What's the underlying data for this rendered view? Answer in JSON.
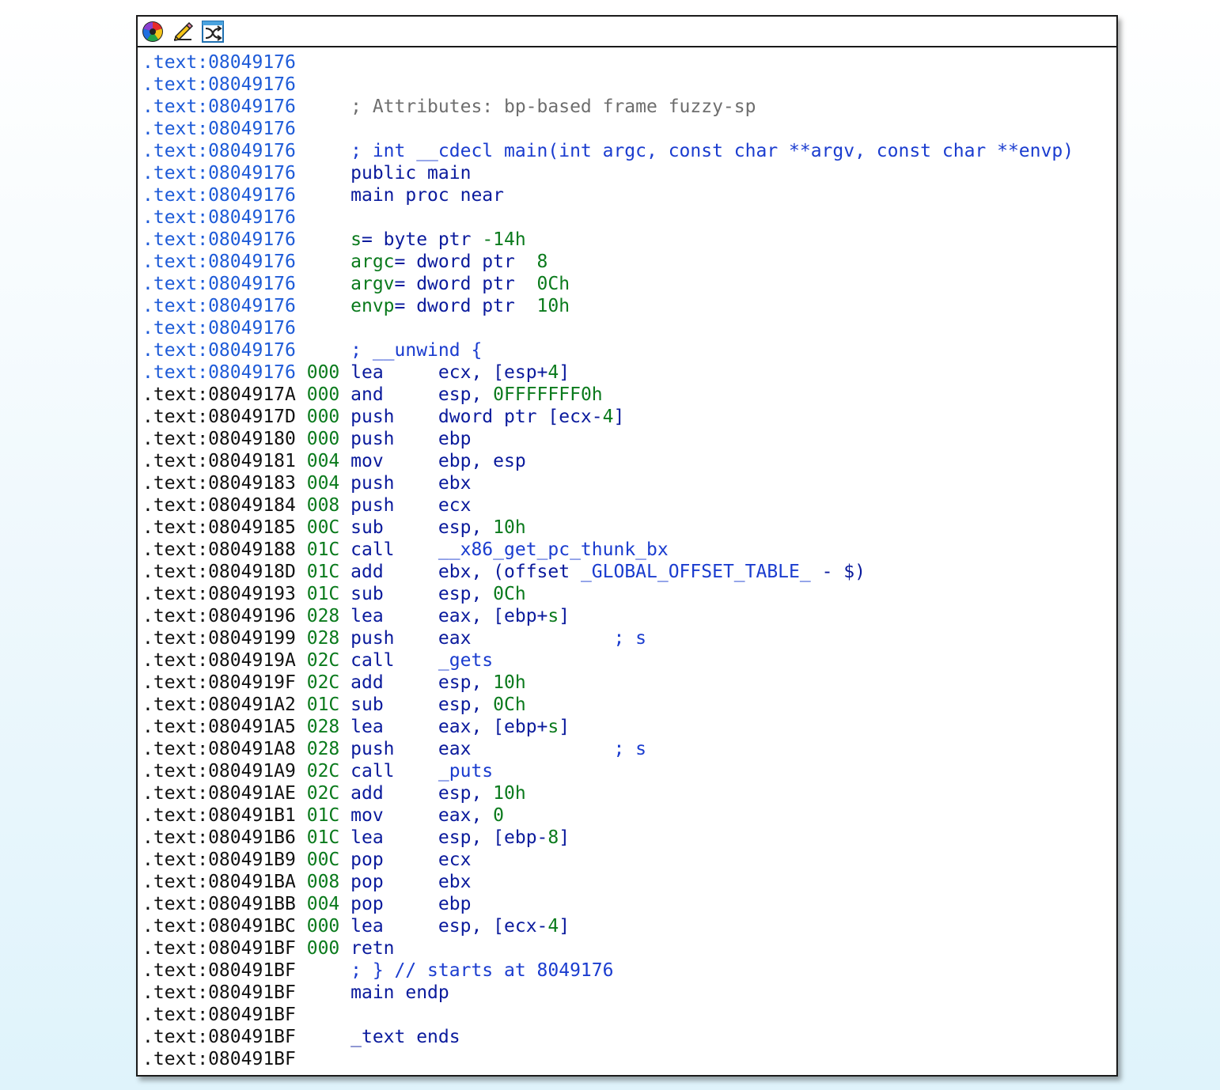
{
  "toolbar": {
    "icons": [
      "color-wheel-icon",
      "pencil-edit-icon",
      "shuffle-graph-icon"
    ]
  },
  "colors": {
    "address_blue": "#1e5bd8",
    "address_black": "#111111",
    "code_navy": "#0a1a9c",
    "stack_green": "#0a7a1c",
    "comment_gray": "#6e6e6e"
  },
  "lines": [
    {
      "addr": ".text:08049176",
      "blue": true,
      "sp": "",
      "parts": []
    },
    {
      "addr": ".text:08049176",
      "blue": true,
      "sp": "",
      "parts": []
    },
    {
      "addr": ".text:08049176",
      "blue": true,
      "sp": "",
      "parts": [
        {
          "t": "; Attributes: bp-based frame fuzzy-sp",
          "c": "cmt-gray"
        }
      ]
    },
    {
      "addr": ".text:08049176",
      "blue": true,
      "sp": "",
      "parts": []
    },
    {
      "addr": ".text:08049176",
      "blue": true,
      "sp": "",
      "parts": [
        {
          "t": "; int __cdecl main(int argc, const char **argv, const char **envp)",
          "c": "cmt-blue"
        }
      ]
    },
    {
      "addr": ".text:08049176",
      "blue": true,
      "sp": "",
      "parts": [
        {
          "t": "public main",
          "c": "dir"
        }
      ]
    },
    {
      "addr": ".text:08049176",
      "blue": true,
      "sp": "",
      "parts": [
        {
          "t": "main proc near",
          "c": "dir"
        }
      ]
    },
    {
      "addr": ".text:08049176",
      "blue": true,
      "sp": "",
      "parts": []
    },
    {
      "addr": ".text:08049176",
      "blue": true,
      "sp": "",
      "parts": [
        {
          "t": "s",
          "c": "g"
        },
        {
          "t": "= byte ptr ",
          "c": "mnem"
        },
        {
          "t": "-14h",
          "c": "g"
        }
      ]
    },
    {
      "addr": ".text:08049176",
      "blue": true,
      "sp": "",
      "parts": [
        {
          "t": "argc",
          "c": "g"
        },
        {
          "t": "= dword ptr  ",
          "c": "mnem"
        },
        {
          "t": "8",
          "c": "g"
        }
      ]
    },
    {
      "addr": ".text:08049176",
      "blue": true,
      "sp": "",
      "parts": [
        {
          "t": "argv",
          "c": "g"
        },
        {
          "t": "= dword ptr  ",
          "c": "mnem"
        },
        {
          "t": "0Ch",
          "c": "g"
        }
      ]
    },
    {
      "addr": ".text:08049176",
      "blue": true,
      "sp": "",
      "parts": [
        {
          "t": "envp",
          "c": "g"
        },
        {
          "t": "= dword ptr  ",
          "c": "mnem"
        },
        {
          "t": "10h",
          "c": "g"
        }
      ]
    },
    {
      "addr": ".text:08049176",
      "blue": true,
      "sp": "",
      "parts": []
    },
    {
      "addr": ".text:08049176",
      "blue": true,
      "sp": "",
      "parts": [
        {
          "t": "; __unwind {",
          "c": "cmt-blue"
        }
      ]
    },
    {
      "addr": ".text:08049176",
      "blue": true,
      "sp": "000",
      "parts": [
        {
          "t": "lea     ",
          "c": "mnem"
        },
        {
          "t": "ecx, [esp+",
          "c": "opnd"
        },
        {
          "t": "4",
          "c": "g"
        },
        {
          "t": "]",
          "c": "opnd"
        }
      ]
    },
    {
      "addr": ".text:0804917A",
      "blue": false,
      "sp": "000",
      "parts": [
        {
          "t": "and     ",
          "c": "mnem"
        },
        {
          "t": "esp, ",
          "c": "opnd"
        },
        {
          "t": "0FFFFFFF0h",
          "c": "g"
        }
      ]
    },
    {
      "addr": ".text:0804917D",
      "blue": false,
      "sp": "000",
      "parts": [
        {
          "t": "push    ",
          "c": "mnem"
        },
        {
          "t": "dword ptr [ecx-",
          "c": "opnd"
        },
        {
          "t": "4",
          "c": "g"
        },
        {
          "t": "]",
          "c": "opnd"
        }
      ]
    },
    {
      "addr": ".text:08049180",
      "blue": false,
      "sp": "000",
      "parts": [
        {
          "t": "push    ",
          "c": "mnem"
        },
        {
          "t": "ebp",
          "c": "opnd"
        }
      ]
    },
    {
      "addr": ".text:08049181",
      "blue": false,
      "sp": "004",
      "parts": [
        {
          "t": "mov     ",
          "c": "mnem"
        },
        {
          "t": "ebp, esp",
          "c": "opnd"
        }
      ]
    },
    {
      "addr": ".text:08049183",
      "blue": false,
      "sp": "004",
      "parts": [
        {
          "t": "push    ",
          "c": "mnem"
        },
        {
          "t": "ebx",
          "c": "opnd"
        }
      ]
    },
    {
      "addr": ".text:08049184",
      "blue": false,
      "sp": "008",
      "parts": [
        {
          "t": "push    ",
          "c": "mnem"
        },
        {
          "t": "ecx",
          "c": "opnd"
        }
      ]
    },
    {
      "addr": ".text:08049185",
      "blue": false,
      "sp": "00C",
      "parts": [
        {
          "t": "sub     ",
          "c": "mnem"
        },
        {
          "t": "esp, ",
          "c": "opnd"
        },
        {
          "t": "10h",
          "c": "g"
        }
      ]
    },
    {
      "addr": ".text:08049188",
      "blue": false,
      "sp": "01C",
      "parts": [
        {
          "t": "call    ",
          "c": "mnem"
        },
        {
          "t": "__x86_get_pc_thunk_bx",
          "c": "cmt-blue"
        }
      ]
    },
    {
      "addr": ".text:0804918D",
      "blue": false,
      "sp": "01C",
      "parts": [
        {
          "t": "add     ",
          "c": "mnem"
        },
        {
          "t": "ebx, (offset ",
          "c": "opnd"
        },
        {
          "t": "_GLOBAL_OFFSET_TABLE_",
          "c": "cmt-blue"
        },
        {
          "t": " - $)",
          "c": "opnd"
        }
      ]
    },
    {
      "addr": ".text:08049193",
      "blue": false,
      "sp": "01C",
      "parts": [
        {
          "t": "sub     ",
          "c": "mnem"
        },
        {
          "t": "esp, ",
          "c": "opnd"
        },
        {
          "t": "0Ch",
          "c": "g"
        }
      ]
    },
    {
      "addr": ".text:08049196",
      "blue": false,
      "sp": "028",
      "parts": [
        {
          "t": "lea     ",
          "c": "mnem"
        },
        {
          "t": "eax, [ebp+",
          "c": "opnd"
        },
        {
          "t": "s",
          "c": "g"
        },
        {
          "t": "]",
          "c": "opnd"
        }
      ]
    },
    {
      "addr": ".text:08049199",
      "blue": false,
      "sp": "028",
      "parts": [
        {
          "t": "push    ",
          "c": "mnem"
        },
        {
          "t": "eax             ",
          "c": "opnd"
        },
        {
          "t": "; s",
          "c": "cmt-blue"
        }
      ]
    },
    {
      "addr": ".text:0804919A",
      "blue": false,
      "sp": "02C",
      "parts": [
        {
          "t": "call    ",
          "c": "mnem"
        },
        {
          "t": "_gets",
          "c": "cmt-blue"
        }
      ]
    },
    {
      "addr": ".text:0804919F",
      "blue": false,
      "sp": "02C",
      "parts": [
        {
          "t": "add     ",
          "c": "mnem"
        },
        {
          "t": "esp, ",
          "c": "opnd"
        },
        {
          "t": "10h",
          "c": "g"
        }
      ]
    },
    {
      "addr": ".text:080491A2",
      "blue": false,
      "sp": "01C",
      "parts": [
        {
          "t": "sub     ",
          "c": "mnem"
        },
        {
          "t": "esp, ",
          "c": "opnd"
        },
        {
          "t": "0Ch",
          "c": "g"
        }
      ]
    },
    {
      "addr": ".text:080491A5",
      "blue": false,
      "sp": "028",
      "parts": [
        {
          "t": "lea     ",
          "c": "mnem"
        },
        {
          "t": "eax, [ebp+",
          "c": "opnd"
        },
        {
          "t": "s",
          "c": "g"
        },
        {
          "t": "]",
          "c": "opnd"
        }
      ]
    },
    {
      "addr": ".text:080491A8",
      "blue": false,
      "sp": "028",
      "parts": [
        {
          "t": "push    ",
          "c": "mnem"
        },
        {
          "t": "eax             ",
          "c": "opnd"
        },
        {
          "t": "; s",
          "c": "cmt-blue"
        }
      ]
    },
    {
      "addr": ".text:080491A9",
      "blue": false,
      "sp": "02C",
      "parts": [
        {
          "t": "call    ",
          "c": "mnem"
        },
        {
          "t": "_puts",
          "c": "cmt-blue"
        }
      ]
    },
    {
      "addr": ".text:080491AE",
      "blue": false,
      "sp": "02C",
      "parts": [
        {
          "t": "add     ",
          "c": "mnem"
        },
        {
          "t": "esp, ",
          "c": "opnd"
        },
        {
          "t": "10h",
          "c": "g"
        }
      ]
    },
    {
      "addr": ".text:080491B1",
      "blue": false,
      "sp": "01C",
      "parts": [
        {
          "t": "mov     ",
          "c": "mnem"
        },
        {
          "t": "eax, ",
          "c": "opnd"
        },
        {
          "t": "0",
          "c": "g"
        }
      ]
    },
    {
      "addr": ".text:080491B6",
      "blue": false,
      "sp": "01C",
      "parts": [
        {
          "t": "lea     ",
          "c": "mnem"
        },
        {
          "t": "esp, [ebp-",
          "c": "opnd"
        },
        {
          "t": "8",
          "c": "g"
        },
        {
          "t": "]",
          "c": "opnd"
        }
      ]
    },
    {
      "addr": ".text:080491B9",
      "blue": false,
      "sp": "00C",
      "parts": [
        {
          "t": "pop     ",
          "c": "mnem"
        },
        {
          "t": "ecx",
          "c": "opnd"
        }
      ]
    },
    {
      "addr": ".text:080491BA",
      "blue": false,
      "sp": "008",
      "parts": [
        {
          "t": "pop     ",
          "c": "mnem"
        },
        {
          "t": "ebx",
          "c": "opnd"
        }
      ]
    },
    {
      "addr": ".text:080491BB",
      "blue": false,
      "sp": "004",
      "parts": [
        {
          "t": "pop     ",
          "c": "mnem"
        },
        {
          "t": "ebp",
          "c": "opnd"
        }
      ]
    },
    {
      "addr": ".text:080491BC",
      "blue": false,
      "sp": "000",
      "parts": [
        {
          "t": "lea     ",
          "c": "mnem"
        },
        {
          "t": "esp, [ecx-",
          "c": "opnd"
        },
        {
          "t": "4",
          "c": "g"
        },
        {
          "t": "]",
          "c": "opnd"
        }
      ]
    },
    {
      "addr": ".text:080491BF",
      "blue": false,
      "sp": "000",
      "parts": [
        {
          "t": "retn",
          "c": "mnem"
        }
      ]
    },
    {
      "addr": ".text:080491BF",
      "blue": false,
      "sp": "",
      "parts": [
        {
          "t": "; } // starts at 8049176",
          "c": "cmt-blue"
        }
      ]
    },
    {
      "addr": ".text:080491BF",
      "blue": false,
      "sp": "",
      "parts": [
        {
          "t": "main endp",
          "c": "dir"
        }
      ]
    },
    {
      "addr": ".text:080491BF",
      "blue": false,
      "sp": "",
      "parts": []
    },
    {
      "addr": ".text:080491BF",
      "blue": false,
      "sp": "",
      "parts": [
        {
          "t": "_text ends",
          "c": "dir"
        }
      ]
    },
    {
      "addr": ".text:080491BF",
      "blue": false,
      "sp": "",
      "parts": []
    }
  ]
}
